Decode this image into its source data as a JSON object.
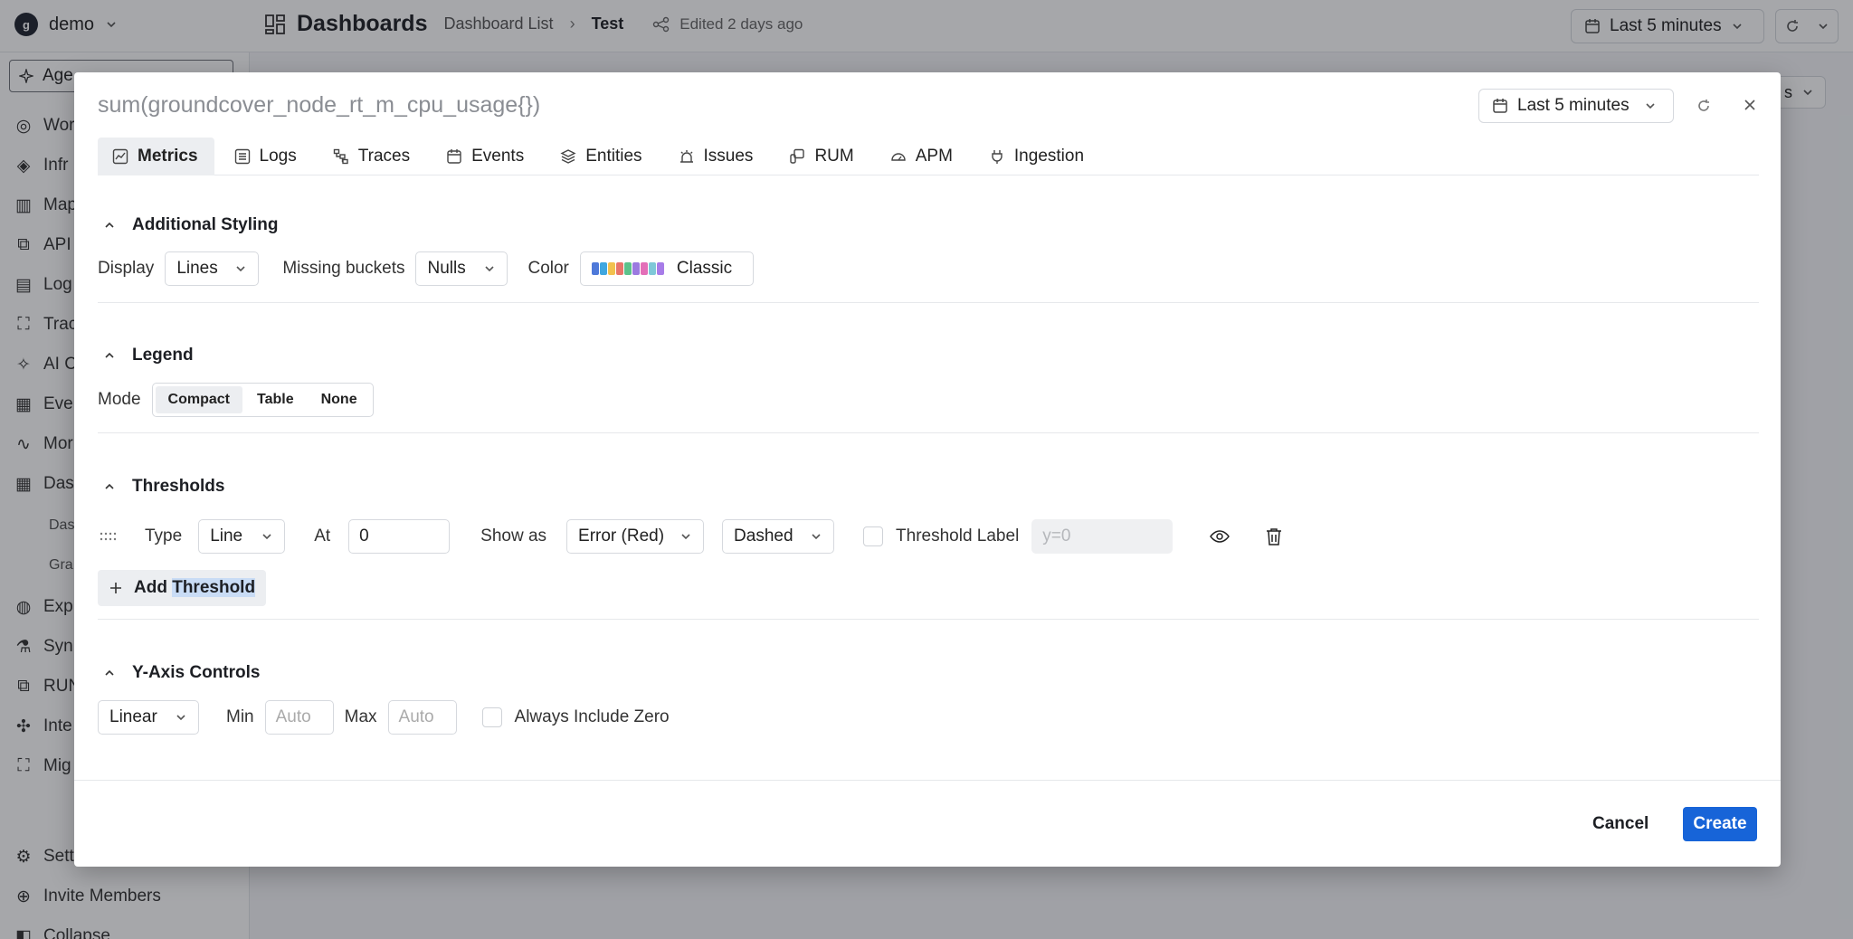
{
  "app": {
    "org": "demo",
    "org_logo": "g",
    "page_title": "Dashboards",
    "breadcrumb_list": "Dashboard List",
    "breadcrumb_current": "Test",
    "edited": "Edited 2 days ago",
    "time_range": "Last 5 minutes",
    "main_button_fragment": "s"
  },
  "sidebar": {
    "agent_label": "Age",
    "items": [
      {
        "label": "Wor",
        "icon": "globe-icon"
      },
      {
        "label": "Infr",
        "icon": "layers-icon"
      },
      {
        "label": "Map",
        "icon": "map-icon"
      },
      {
        "label": "API",
        "icon": "api-icon"
      },
      {
        "label": "Log",
        "icon": "list-icon"
      },
      {
        "label": "Trac",
        "icon": "traces-icon"
      },
      {
        "label": "AI C",
        "icon": "ai-icon"
      },
      {
        "label": "Eve",
        "icon": "calendar-icon"
      },
      {
        "label": "Mor",
        "icon": "pulse-icon"
      },
      {
        "label": "Das",
        "icon": "dashboard-icon"
      }
    ],
    "sub_items": [
      "Das",
      "Gra"
    ],
    "items2": [
      {
        "label": "Exp",
        "icon": "compass-icon"
      },
      {
        "label": "Syn",
        "icon": "flask-icon"
      },
      {
        "label": "RUN",
        "icon": "rum-icon"
      },
      {
        "label": "Inte",
        "icon": "puzzle-icon"
      },
      {
        "label": "Mig",
        "icon": "migrate-icon"
      }
    ],
    "settings": "Sett",
    "invite": "Invite Members",
    "collapse": "Collapse"
  },
  "modal": {
    "title": "sum(groundcover_node_rt_m_cpu_usage{})",
    "time_range": "Last 5 minutes",
    "tabs": [
      {
        "label": "Metrics",
        "active": true
      },
      {
        "label": "Logs"
      },
      {
        "label": "Traces"
      },
      {
        "label": "Events"
      },
      {
        "label": "Entities"
      },
      {
        "label": "Issues"
      },
      {
        "label": "RUM"
      },
      {
        "label": "APM"
      },
      {
        "label": "Ingestion"
      }
    ],
    "styling": {
      "heading": "Additional Styling",
      "display_label": "Display",
      "display_value": "Lines",
      "missing_label": "Missing buckets",
      "missing_value": "Nulls",
      "color_label": "Color",
      "color_value": "Classic",
      "palette": [
        "#4e79d9",
        "#3fa7e0",
        "#f2c14e",
        "#e8746a",
        "#5cc28b",
        "#9b7ae0",
        "#e36fb8",
        "#7fc8d8",
        "#a77ce8"
      ]
    },
    "legend": {
      "heading": "Legend",
      "mode_label": "Mode",
      "options": [
        "Compact",
        "Table",
        "None"
      ],
      "selected": "Compact"
    },
    "thresholds": {
      "heading": "Thresholds",
      "type_label": "Type",
      "type_value": "Line",
      "at_label": "At",
      "at_value": "0",
      "show_as_label": "Show as",
      "show_as_value": "Error (Red)",
      "style_value": "Dashed",
      "label_label": "Threshold Label",
      "label_placeholder": "y=0",
      "add_prefix": "Add ",
      "add_highlight": "Threshold"
    },
    "yaxis": {
      "heading": "Y-Axis Controls",
      "scale_value": "Linear",
      "min_label": "Min",
      "min_placeholder": "Auto",
      "max_label": "Max",
      "max_placeholder": "Auto",
      "zero_label": "Always Include Zero"
    },
    "footer": {
      "cancel": "Cancel",
      "create": "Create"
    }
  }
}
